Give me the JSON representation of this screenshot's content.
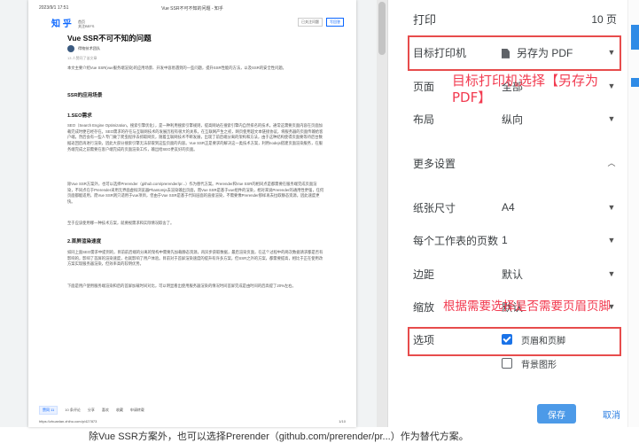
{
  "preview": {
    "timestamp": "2023/9/1 17:51",
    "page_title": "Vue SSR不可不知的问题 - 知乎",
    "logo": "知 乎",
    "logo_sub1": "首页",
    "logo_sub2": "关注BEFS",
    "action_btn1": "已关注问题",
    "action_btn2": "写回答",
    "title": "Vue SSR不可不知的问题",
    "author": "得物技术团队",
    "meta": "13 人赞同了该文章",
    "intro": "本文主要介绍Vue SSR(vue服务端渲染)的应用场景、开发中容易遇到的一些问题，提升SSR性能的方法，以及SSR的安全性问题。",
    "h_ssr": "SSR的应用场景",
    "h_seo": "1.SEO需求",
    "p_seo": "SEO（Search Engine Optimization，搜索引擎优化），是一种利用搜索引擎规则，提高网站在搜索引擎内自然排名的技术。通常这需要页面内容在页面加载完成时便已经存在。SEO需求的存在与互联网技术的发展历程有很大的关系。在互联网产生之初，网页使用超文本链接协议，将服务器的页面传输给客户端。然后会有一些人专门做了爬虫程序去抓取网页，随着互联网技术不断发展，出现了前后端分离的架构和方法，由于这种结构使得页面要等待后台数据返回后再进行渲染，因此大部分搜索引擎无法获取到这些页面的内容。Vue SSR正是要求的解决这一类技术方案，利用nodejs搭建页面渲染服务，在服务端完成之前需要在客户端完成的页面渲染工作，输出给SEO更友好的页面。",
    "p_prerender": "除Vue SSR方案外，也可以选择Prerender（github.com/prerender/pr...）作为替代方案。Prerender和Vue SSR的相同点是都需要在服务端完成页面渲染，不同点在于Prerender采用无界面虚拟浏览器Phantomjs去渲染输出页面，而Vue SSR是基于vue组件的渲染，相对来说Prerender的通用性更强，任何页面都能适用，而Vue SSR则只适用于vue项目，但由于Vue SSR是基于代码层面的直接渲染，不需要像Prerender那样再去拉取静态资源，因此速度更快。",
    "p_choose": "至于应该使用哪一种技术方案，就要视需求和实际情况取舍了。",
    "h_speed": "2.首屏渲染速度",
    "p_speed": "如同上面SEO需求中提到的，目前前后端的分离的架构中需要先加载静态资源，再异步获取数据，最后渲染页面，在这个过程中的两次数据请求都是否有影响的，影响了首屏的渲染速度，也就影响了用户体验。目前对于首屏渲染速度的提升有许多方案，但SSR之外的方案，都需要提高，相比于正在使用改方案实现服务器渲染，但效率高的较明优势。",
    "p_test": "下面是用户使用服务端渲染和后的首屏加载时间对比，可以明显看出使用服务器渲染的情况时间首屏完成是由时间的后高提了20%左右。",
    "vote": "赞同 11",
    "comments": "10 条评论",
    "share": "分享",
    "like": "喜欢",
    "collect": "收藏",
    "apply": "申请转载",
    "url": "https://zhuanlan.zhihu.com/p/427873",
    "page_no": "1/10"
  },
  "panel": {
    "title": "打印",
    "pages": "10 页",
    "printer_label": "目标打印机",
    "printer_value": "另存为 PDF",
    "pages_label": "页面",
    "pages_value": "全部",
    "layout_label": "布局",
    "layout_value": "纵向",
    "more_settings": "更多设置",
    "paper_label": "纸张尺寸",
    "paper_value": "A4",
    "pps_label": "每个工作表的页数",
    "pps_value": "1",
    "margins_label": "边距",
    "margins_value": "默认",
    "scale_label": "缩放",
    "scale_value": "默认",
    "options_label": "选项",
    "opt_headers": "页眉和页脚",
    "opt_headers_checked": true,
    "opt_bg": "背景图形",
    "opt_bg_checked": false,
    "save": "保存",
    "cancel": "取消"
  },
  "annotations": {
    "printer_note": "目标打印机选择【另存为PDF】",
    "header_note": "根据需要选择是否需要页眉页脚"
  },
  "caption": "除Vue SSR方案外，也可以选择Prerender（github.com/prerender/pr...）作为替代方案。",
  "colors": {
    "accent": "#1a73e8",
    "annotation": "#f23b50",
    "save_button": "#4c9ae8",
    "zhihu_blue": "#0a66ff"
  }
}
